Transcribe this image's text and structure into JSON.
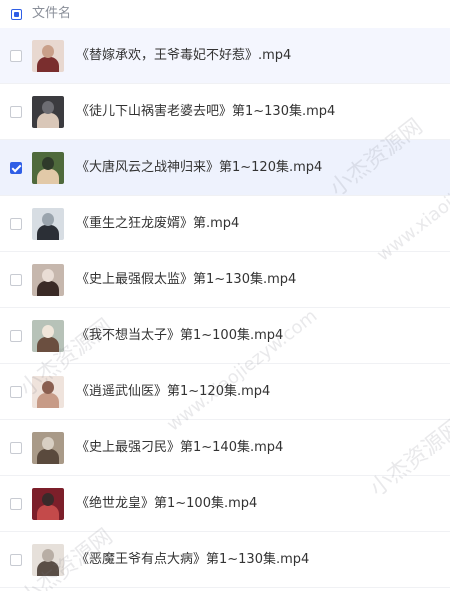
{
  "header": {
    "label": "文件名"
  },
  "files": [
    {
      "name": "《替嫁承欢，王爷毒妃不好惹》.mp4",
      "checked": false,
      "thumb": [
        "#e8d8d0",
        "#7a2e2e",
        "#c9a08a"
      ]
    },
    {
      "name": "《徒儿下山祸害老婆去吧》第1~130集.mp4",
      "checked": false,
      "thumb": [
        "#3b3b3f",
        "#d9c7b8",
        "#6d6d73"
      ]
    },
    {
      "name": "《大唐风云之战神归来》第1~120集.mp4",
      "checked": true,
      "thumb": [
        "#4f6a3c",
        "#e2c9a8",
        "#2f3a2a"
      ]
    },
    {
      "name": "《重生之狂龙废婿》第.mp4",
      "checked": false,
      "thumb": [
        "#d7dde3",
        "#2b2f36",
        "#9aa4ad"
      ]
    },
    {
      "name": "《史上最强假太监》第1~130集.mp4",
      "checked": false,
      "thumb": [
        "#c6b7ad",
        "#3a2a26",
        "#e9ddd5"
      ]
    },
    {
      "name": "《我不想当太子》第1~100集.mp4",
      "checked": false,
      "thumb": [
        "#b7c2b8",
        "#6b4f40",
        "#f0e6da"
      ]
    },
    {
      "name": "《逍遥武仙医》第1~120集.mp4",
      "checked": false,
      "thumb": [
        "#efe3dc",
        "#c79b87",
        "#8a5f50"
      ]
    },
    {
      "name": "《史上最强刁民》第1~140集.mp4",
      "checked": false,
      "thumb": [
        "#a99a88",
        "#5a4a3d",
        "#d8cfc3"
      ]
    },
    {
      "name": "《绝世龙皇》第1~100集.mp4",
      "checked": false,
      "thumb": [
        "#7c1f2a",
        "#c44a4a",
        "#3a2a2a"
      ]
    },
    {
      "name": "《恶魔王爷有点大病》第1~130集.mp4",
      "checked": false,
      "thumb": [
        "#e6e0da",
        "#5a4e46",
        "#b8aea5"
      ]
    }
  ],
  "watermark": {
    "text_cn": "小杰资源网",
    "text_url": "www.xiaojiezyw.com"
  },
  "colors": {
    "accent": "#2f5ee6",
    "row_hover": "#f4f6fe",
    "text": "#333333",
    "muted": "#8a8f99"
  }
}
